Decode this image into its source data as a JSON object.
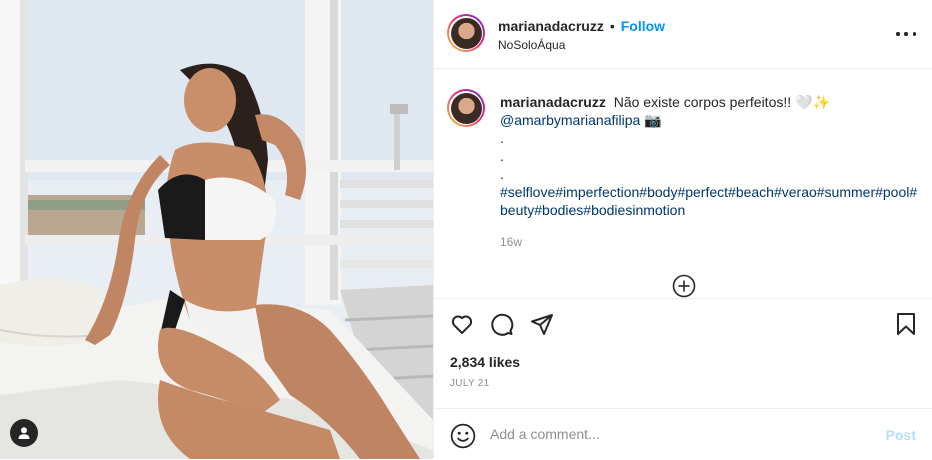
{
  "post": {
    "username": "marianadacruzz",
    "separator": "•",
    "follow_label": "Follow",
    "location": "NoSoloÁqua",
    "caption": {
      "username": "marianadacruzz",
      "text": "Não existe corpos perfeitos!! 🤍✨",
      "mention": "@amarbymarianafilipa 📷",
      "dots": [
        ".",
        ".",
        "."
      ],
      "hashtags_line1": "#selflove#imperfection#body#perfect#beach#verao#summer#pool#",
      "hashtags_line2": "beuty#bodies#bodiesinmotion"
    },
    "timestamp": "16w",
    "likes": "2,834 likes",
    "date": "JULY 21",
    "comment_placeholder": "Add a comment...",
    "post_label": "Post"
  },
  "icons": {
    "more": "more-options-icon",
    "load_more": "plus-circle-icon",
    "like": "heart-icon",
    "comment": "comment-bubble-icon",
    "share": "paper-plane-icon",
    "save": "bookmark-icon",
    "emoji": "smiley-icon",
    "user_tag": "user-icon"
  },
  "colors": {
    "accent": "#0095f6",
    "link": "#00376b",
    "muted": "#8e8e8e",
    "post_disabled": "#b2dffc"
  }
}
